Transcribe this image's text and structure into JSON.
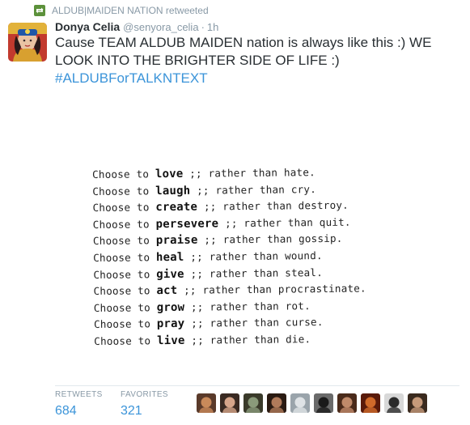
{
  "retweet_header": {
    "text": "ALDUB|MAIDEN NATION retweeted",
    "icon": "retweet-icon",
    "icon_color": "#5c913b"
  },
  "tweet": {
    "fullname": "Donya Celia",
    "username": "@senyora_celia",
    "separator": "·",
    "time": "1h",
    "text_plain": "Cause TEAM ALDUB MAIDEN nation is always like this :) WE LOOK INTO THE BRIGHTER SIDE OF LIFE :) ",
    "hashtag": "#ALDUBForTALKNTEXT",
    "hashtag_color": "#3b94d9"
  },
  "media": {
    "lines": [
      {
        "prefix": "Choose to",
        "verb": "love",
        "suffix": ";; rather than hate."
      },
      {
        "prefix": "Choose to",
        "verb": "laugh",
        "suffix": ";; rather than cry."
      },
      {
        "prefix": "Choose to",
        "verb": "create",
        "suffix": ";; rather than destroy."
      },
      {
        "prefix": "Choose to",
        "verb": "persevere",
        "suffix": ";; rather than quit."
      },
      {
        "prefix": "Choose to",
        "verb": "praise",
        "suffix": ";; rather than gossip."
      },
      {
        "prefix": "Choose to",
        "verb": "heal",
        "suffix": ";; rather than wound."
      },
      {
        "prefix": "Choose to",
        "verb": "give",
        "suffix": ";; rather than steal."
      },
      {
        "prefix": "Choose to",
        "verb": "act",
        "suffix": ";; rather than procrastinate."
      },
      {
        "prefix": "Choose to",
        "verb": "grow",
        "suffix": ";; rather than rot."
      },
      {
        "prefix": "Choose to",
        "verb": "pray",
        "suffix": ";; rather than curse."
      },
      {
        "prefix": "Choose to",
        "verb": "live",
        "suffix": ";; rather than die."
      }
    ]
  },
  "stats": {
    "retweets_label": "RETWEETS",
    "retweets_value": "684",
    "favorites_label": "FAVORITES",
    "favorites_value": "321"
  },
  "favoriters": [
    {
      "name": "favoriter-avatar-1",
      "colors": [
        "#c98a5a",
        "#5a3a2a"
      ]
    },
    {
      "name": "favoriter-avatar-2",
      "colors": [
        "#d6a58a",
        "#3a2a22"
      ]
    },
    {
      "name": "favoriter-avatar-3",
      "colors": [
        "#8a9a7a",
        "#3a3a2a"
      ]
    },
    {
      "name": "favoriter-avatar-4",
      "colors": [
        "#b07a5a",
        "#2a1a12"
      ]
    },
    {
      "name": "favoriter-avatar-5",
      "colors": [
        "#dfe3e6",
        "#9aa4ab"
      ]
    },
    {
      "name": "favoriter-avatar-6",
      "colors": [
        "#1a1a1a",
        "#6a6a6a"
      ]
    },
    {
      "name": "favoriter-avatar-7",
      "colors": [
        "#c08a6a",
        "#4a2a1a"
      ]
    },
    {
      "name": "favoriter-avatar-8",
      "colors": [
        "#d06a2a",
        "#5a1a0a"
      ]
    },
    {
      "name": "favoriter-avatar-9",
      "colors": [
        "#2a2a2a",
        "#d8d8d8"
      ]
    },
    {
      "name": "favoriter-avatar-10",
      "colors": [
        "#c69a7a",
        "#3a2a1e"
      ]
    }
  ],
  "colors": {
    "muted": "#8899a6",
    "link": "#3b94d9",
    "text": "#292f33"
  }
}
